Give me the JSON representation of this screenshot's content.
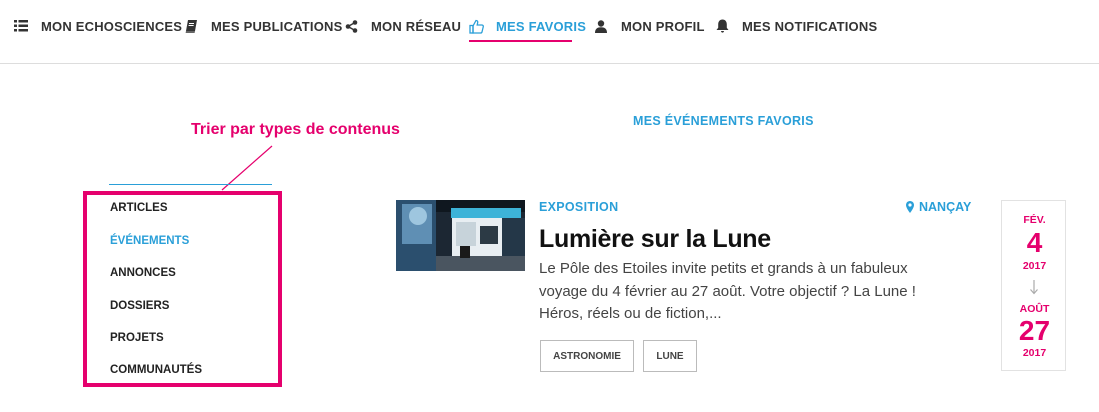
{
  "nav": {
    "items": [
      {
        "label": "MON ECHOSCIENCES",
        "icon": "list-icon"
      },
      {
        "label": "MES PUBLICATIONS",
        "icon": "book-icon"
      },
      {
        "label": "MON RÉSEAU",
        "icon": "share-icon"
      },
      {
        "label": "MES FAVORIS",
        "icon": "thumbs-up-icon",
        "active": true
      },
      {
        "label": "MON PROFIL",
        "icon": "user-icon"
      },
      {
        "label": "MES NOTIFICATIONS",
        "icon": "bell-icon"
      }
    ]
  },
  "annotation": {
    "text": "Trier par types de contenus"
  },
  "sidebar": {
    "items": [
      {
        "label": "ARTICLES"
      },
      {
        "label": "ÉVÉNEMENTS",
        "active": true
      },
      {
        "label": "ANNONCES"
      },
      {
        "label": "DOSSIERS"
      },
      {
        "label": "PROJETS"
      },
      {
        "label": "COMMUNAUTÉS"
      }
    ]
  },
  "main": {
    "section_title": "MES ÉVÉNEMENTS FAVORIS",
    "event": {
      "type": "EXPOSITION",
      "location": "NANÇAY",
      "title": "Lumière sur la Lune",
      "description": "Le Pôle des Etoiles invite petits et grands à un fabuleux voyage du 4 février au 27 août. Votre objectif ? La Lune ! Héros, réels ou de fiction,...",
      "tags": [
        "ASTRONOMIE",
        "LUNE"
      ],
      "start": {
        "month": "FÉV.",
        "day": "4",
        "year": "2017"
      },
      "end": {
        "month": "AOÛT",
        "day": "27",
        "year": "2017"
      }
    }
  },
  "colors": {
    "accent": "#2a9fd8",
    "highlight": "#e5006d",
    "text": "#333333"
  }
}
